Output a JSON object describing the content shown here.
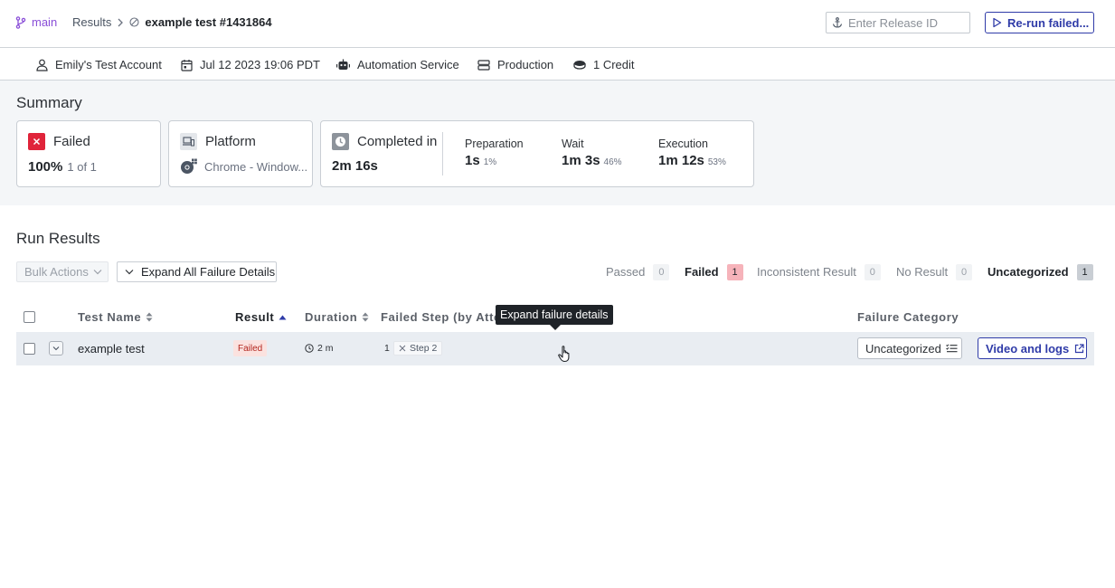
{
  "header": {
    "branch": "main",
    "breadcrumb_root": "Results",
    "breadcrumb_current": "example test #1431864",
    "release_placeholder": "Enter Release ID",
    "rerun_label": "Re-run failed..."
  },
  "meta": {
    "account": "Emily's Test Account",
    "date": "Jul 12 2023 19:06 PDT",
    "service": "Automation Service",
    "environment": "Production",
    "credits": "1 Credit"
  },
  "summary": {
    "title": "Summary",
    "status_card": {
      "label": "Failed",
      "percent": "100%",
      "count": "1 of 1",
      "color": "#e0243a"
    },
    "platform_card": {
      "label": "Platform",
      "value": "Chrome - Window..."
    },
    "time_card": {
      "label": "Completed in",
      "total": "2m 16s",
      "phases": [
        {
          "label": "Preparation",
          "value": "1s",
          "percent": "1%"
        },
        {
          "label": "Wait",
          "value": "1m 3s",
          "percent": "46%"
        },
        {
          "label": "Execution",
          "value": "1m 12s",
          "percent": "53%"
        }
      ]
    }
  },
  "run_results": {
    "title": "Run Results",
    "bulk_actions": "Bulk Actions",
    "expand_all": "Expand All Failure Details",
    "filters": [
      {
        "label": "Passed",
        "count": "0"
      },
      {
        "label": "Failed",
        "count": "1"
      },
      {
        "label": "Inconsistent Result",
        "count": "0"
      },
      {
        "label": "No Result",
        "count": "0"
      },
      {
        "label": "Uncategorized",
        "count": "1"
      }
    ],
    "columns": {
      "test_name": "Test Name",
      "result": "Result",
      "duration": "Duration",
      "failed_step": "Failed Step (by Atte",
      "failure_category": "Failure Category"
    },
    "rows": [
      {
        "name": "example test",
        "result": "Failed",
        "duration": "2 m",
        "attempt": "1",
        "step": "Step 2",
        "category": "Uncategorized",
        "video_label": "Video and logs"
      }
    ],
    "tooltip": "Expand failure details"
  },
  "colors": {
    "accent": "#2f3ba8",
    "branch": "#8a4fd8",
    "failed": "#e0243a",
    "row_bg": "#e9edf2"
  }
}
